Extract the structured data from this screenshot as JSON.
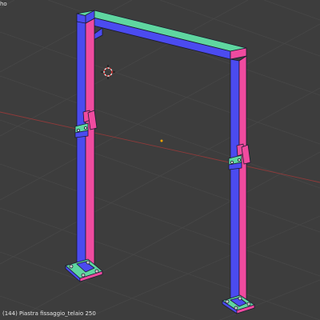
{
  "viewport": {
    "view_name": "ho",
    "object_info": "(144) Piastra fissaggio_telaio 250"
  },
  "colors": {
    "background": "#3d3d3d",
    "grid_line": "#474747",
    "x_axis": "#8f3a3a",
    "face_blue": "#4b4bf0",
    "face_pink": "#f04b9f",
    "face_green": "#5fd6a0",
    "edge": "#1a1a2e",
    "origin": "#f0a500"
  },
  "icons": {
    "cursor": "3d-cursor-icon",
    "origin": "origin-point-icon"
  }
}
